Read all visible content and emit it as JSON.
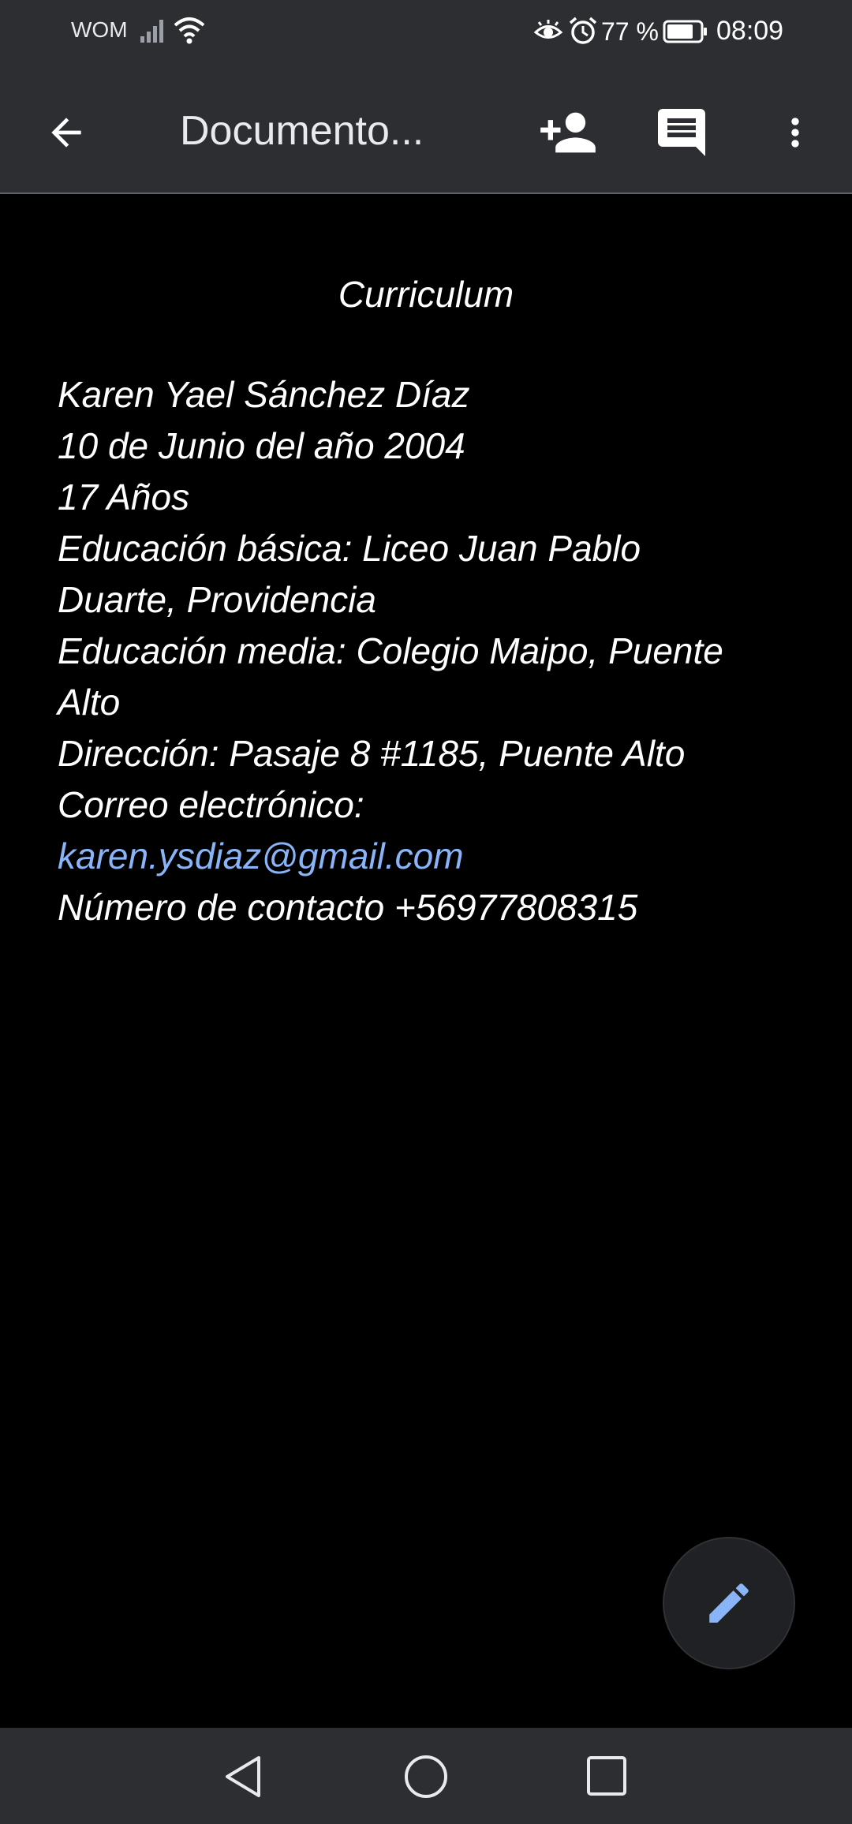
{
  "status_bar": {
    "carrier": "WOM",
    "battery": "77 %",
    "time": "08:09",
    "icons": [
      "signal-icon",
      "wifi-icon",
      "eye-comfort-icon",
      "alarm-icon",
      "battery-icon"
    ]
  },
  "app_bar": {
    "title": "Documento...",
    "icons": [
      "back-arrow-icon",
      "add-person-icon",
      "comment-icon",
      "more-vert-icon"
    ]
  },
  "document": {
    "heading": "Curriculum",
    "lines": [
      "Karen Yael Sánchez Díaz",
      "10 de Junio del año 2004",
      "17 Años",
      "Educación básica: Liceo Juan Pablo",
      "Duarte, Providencia",
      "Educación media: Colegio Maipo, Puente",
      "Alto",
      "Dirección: Pasaje 8 #1185, Puente Alto",
      "Correo electrónico:",
      "karen.ysdiaz@gmail.com",
      "Número de contacto +56977808315"
    ]
  },
  "fab": {
    "icon": "pencil-edit-icon"
  },
  "nav_bar": {
    "icons": [
      "nav-back-icon",
      "nav-home-icon",
      "nav-recents-icon"
    ]
  },
  "colors": {
    "bar_bg": "#2d2e31",
    "doc_bg": "#000000",
    "text": "#ffffff",
    "link": "#8ab4f8",
    "fab_icon": "#8ab4f8"
  }
}
